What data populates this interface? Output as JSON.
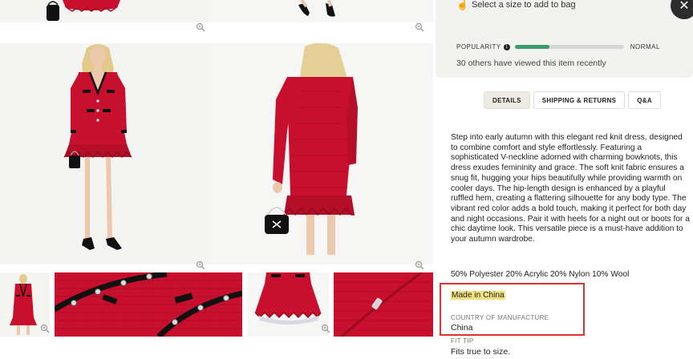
{
  "product": {
    "add_to_bag_prompt": "Select a size to add to bag",
    "popularity": {
      "label": "POPULARITY",
      "level": "NORMAL",
      "fill_fraction": 0.32,
      "views_text": "30 others have viewed this item recently"
    },
    "tabs": [
      {
        "label": "DETAILS",
        "active": true
      },
      {
        "label": "SHIPPING & RETURNS",
        "active": false
      },
      {
        "label": "Q&A",
        "active": false
      }
    ],
    "description": "Step into early autumn with this elegant red knit dress, designed to combine comfort and style effortlessly. Featuring a sophisticated V-neckline adorned with charming bowknots, this dress exudes femininity and grace. The soft knit fabric ensures a snug fit, hugging your hips beautifully while providing warmth on cooler days. The hip-length design is enhanced by a playful ruffled hem, creating a flattering silhouette for any body type. The vibrant red color adds a bold touch, making it perfect for both day and night occasions. Pair it with heels for a night out or boots for a chic daytime look. This versatile piece is a must-have addition to your autumn wardrobe.",
    "composition": "50% Polyester 20% Acrylic 20% Nylon 10% Wool",
    "made_in": "Made in China",
    "country_of_manufacture_label": "COUNTRY OF MANUFACTURE",
    "country_of_manufacture": "China",
    "fit_tip_label": "FIT TIP",
    "fit_tip": "Fits true to size."
  },
  "colors": {
    "dress_red": "#c8102e",
    "popularity_green": "#3d9a6c",
    "highlight_yellow": "#f0e080",
    "annotation_red": "#e53030"
  },
  "icons": {
    "hand": "pointing-hand-icon",
    "close": "close-icon",
    "info": "info-icon",
    "zoom": "zoom-icon"
  }
}
